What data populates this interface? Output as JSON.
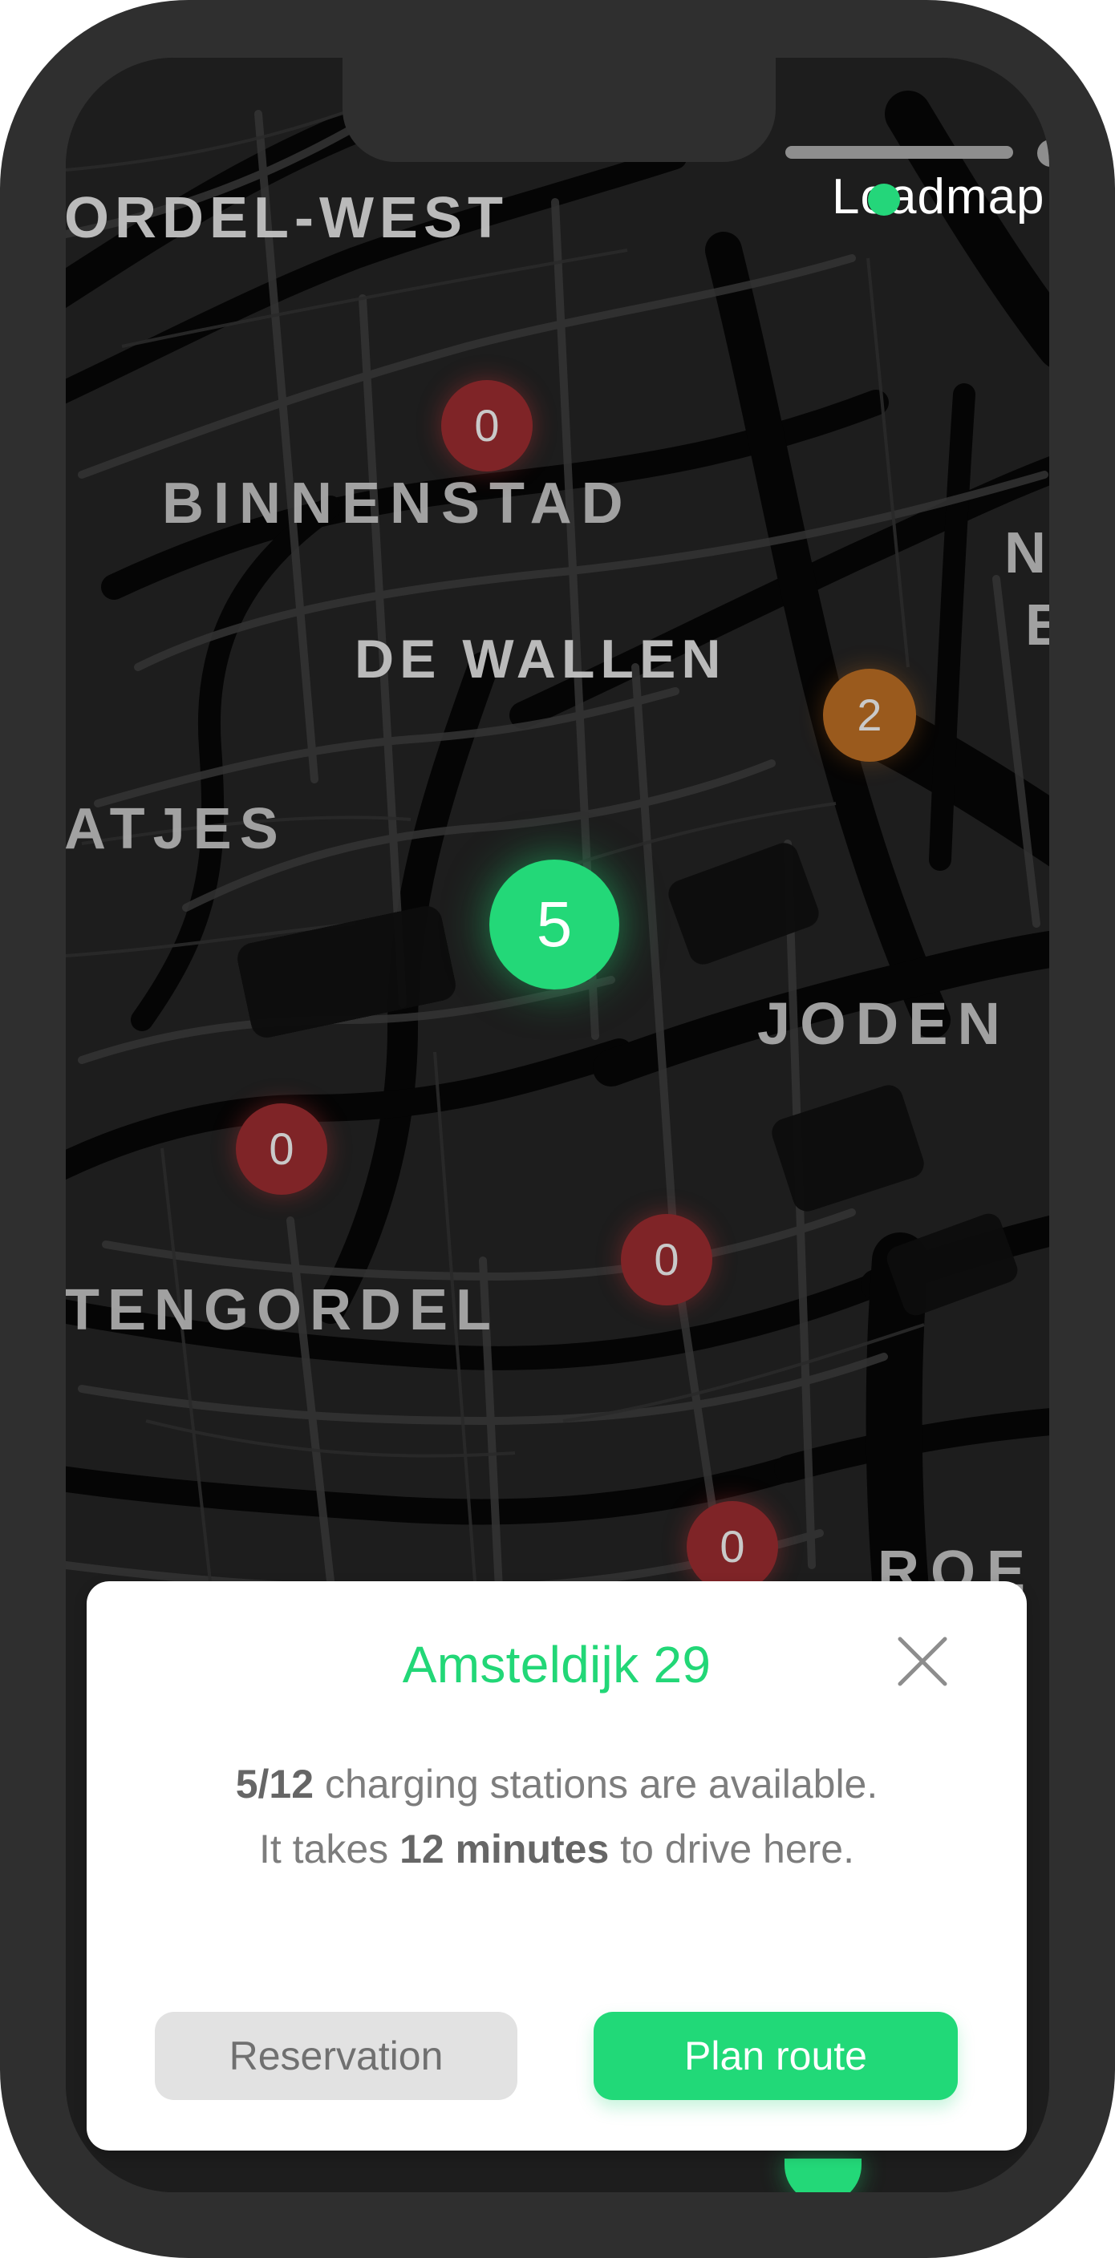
{
  "app": {
    "logo_text": "Loadmap"
  },
  "map": {
    "labels": [
      "ORDEL-WEST",
      "BINNENSTAD",
      "DE WALLEN",
      "ATJES",
      "JODEN",
      "TENGORDEL",
      "N",
      "E",
      "ROE"
    ],
    "markers": [
      {
        "count": "0",
        "status": "unavailable"
      },
      {
        "count": "2",
        "status": "limited"
      },
      {
        "count": "5",
        "status": "available"
      },
      {
        "count": "0",
        "status": "unavailable"
      },
      {
        "count": "0",
        "status": "unavailable"
      },
      {
        "count": "0",
        "status": "unavailable"
      }
    ]
  },
  "station_card": {
    "title": "Amsteldijk 29",
    "available_count": "5/12",
    "availability_text": " charging stations are available.",
    "travel_prefix": "It takes ",
    "travel_time": "12 minutes",
    "travel_suffix": " to drive here.",
    "reservation_label": "Reservation",
    "plan_route_label": "Plan route"
  },
  "colors": {
    "green": "#23D878",
    "red": "#7F2427",
    "orange": "#9A5A1D",
    "map_background": "#1D1D1D"
  },
  "icons": {
    "close": "close-icon"
  }
}
